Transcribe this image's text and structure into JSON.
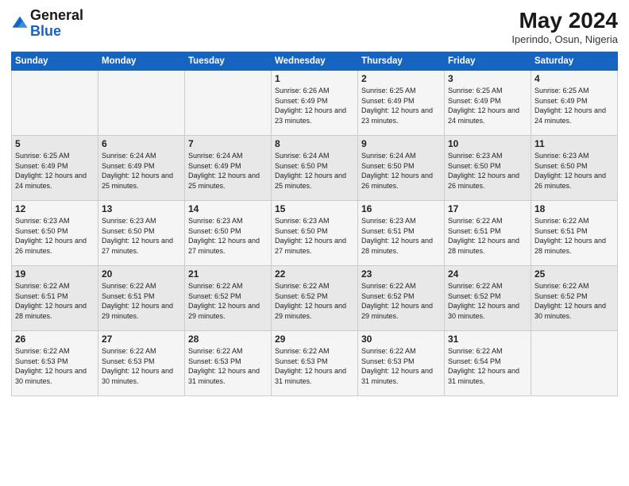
{
  "header": {
    "logo_general": "General",
    "logo_blue": "Blue",
    "month_year": "May 2024",
    "location": "Iperindo, Osun, Nigeria"
  },
  "days_of_week": [
    "Sunday",
    "Monday",
    "Tuesday",
    "Wednesday",
    "Thursday",
    "Friday",
    "Saturday"
  ],
  "weeks": [
    [
      {
        "day": "",
        "info": ""
      },
      {
        "day": "",
        "info": ""
      },
      {
        "day": "",
        "info": ""
      },
      {
        "day": "1",
        "info": "Sunrise: 6:26 AM\nSunset: 6:49 PM\nDaylight: 12 hours and 23 minutes."
      },
      {
        "day": "2",
        "info": "Sunrise: 6:25 AM\nSunset: 6:49 PM\nDaylight: 12 hours and 23 minutes."
      },
      {
        "day": "3",
        "info": "Sunrise: 6:25 AM\nSunset: 6:49 PM\nDaylight: 12 hours and 24 minutes."
      },
      {
        "day": "4",
        "info": "Sunrise: 6:25 AM\nSunset: 6:49 PM\nDaylight: 12 hours and 24 minutes."
      }
    ],
    [
      {
        "day": "5",
        "info": "Sunrise: 6:25 AM\nSunset: 6:49 PM\nDaylight: 12 hours and 24 minutes."
      },
      {
        "day": "6",
        "info": "Sunrise: 6:24 AM\nSunset: 6:49 PM\nDaylight: 12 hours and 25 minutes."
      },
      {
        "day": "7",
        "info": "Sunrise: 6:24 AM\nSunset: 6:49 PM\nDaylight: 12 hours and 25 minutes."
      },
      {
        "day": "8",
        "info": "Sunrise: 6:24 AM\nSunset: 6:50 PM\nDaylight: 12 hours and 25 minutes."
      },
      {
        "day": "9",
        "info": "Sunrise: 6:24 AM\nSunset: 6:50 PM\nDaylight: 12 hours and 26 minutes."
      },
      {
        "day": "10",
        "info": "Sunrise: 6:23 AM\nSunset: 6:50 PM\nDaylight: 12 hours and 26 minutes."
      },
      {
        "day": "11",
        "info": "Sunrise: 6:23 AM\nSunset: 6:50 PM\nDaylight: 12 hours and 26 minutes."
      }
    ],
    [
      {
        "day": "12",
        "info": "Sunrise: 6:23 AM\nSunset: 6:50 PM\nDaylight: 12 hours and 26 minutes."
      },
      {
        "day": "13",
        "info": "Sunrise: 6:23 AM\nSunset: 6:50 PM\nDaylight: 12 hours and 27 minutes."
      },
      {
        "day": "14",
        "info": "Sunrise: 6:23 AM\nSunset: 6:50 PM\nDaylight: 12 hours and 27 minutes."
      },
      {
        "day": "15",
        "info": "Sunrise: 6:23 AM\nSunset: 6:50 PM\nDaylight: 12 hours and 27 minutes."
      },
      {
        "day": "16",
        "info": "Sunrise: 6:23 AM\nSunset: 6:51 PM\nDaylight: 12 hours and 28 minutes."
      },
      {
        "day": "17",
        "info": "Sunrise: 6:22 AM\nSunset: 6:51 PM\nDaylight: 12 hours and 28 minutes."
      },
      {
        "day": "18",
        "info": "Sunrise: 6:22 AM\nSunset: 6:51 PM\nDaylight: 12 hours and 28 minutes."
      }
    ],
    [
      {
        "day": "19",
        "info": "Sunrise: 6:22 AM\nSunset: 6:51 PM\nDaylight: 12 hours and 28 minutes."
      },
      {
        "day": "20",
        "info": "Sunrise: 6:22 AM\nSunset: 6:51 PM\nDaylight: 12 hours and 29 minutes."
      },
      {
        "day": "21",
        "info": "Sunrise: 6:22 AM\nSunset: 6:52 PM\nDaylight: 12 hours and 29 minutes."
      },
      {
        "day": "22",
        "info": "Sunrise: 6:22 AM\nSunset: 6:52 PM\nDaylight: 12 hours and 29 minutes."
      },
      {
        "day": "23",
        "info": "Sunrise: 6:22 AM\nSunset: 6:52 PM\nDaylight: 12 hours and 29 minutes."
      },
      {
        "day": "24",
        "info": "Sunrise: 6:22 AM\nSunset: 6:52 PM\nDaylight: 12 hours and 30 minutes."
      },
      {
        "day": "25",
        "info": "Sunrise: 6:22 AM\nSunset: 6:52 PM\nDaylight: 12 hours and 30 minutes."
      }
    ],
    [
      {
        "day": "26",
        "info": "Sunrise: 6:22 AM\nSunset: 6:53 PM\nDaylight: 12 hours and 30 minutes."
      },
      {
        "day": "27",
        "info": "Sunrise: 6:22 AM\nSunset: 6:53 PM\nDaylight: 12 hours and 30 minutes."
      },
      {
        "day": "28",
        "info": "Sunrise: 6:22 AM\nSunset: 6:53 PM\nDaylight: 12 hours and 31 minutes."
      },
      {
        "day": "29",
        "info": "Sunrise: 6:22 AM\nSunset: 6:53 PM\nDaylight: 12 hours and 31 minutes."
      },
      {
        "day": "30",
        "info": "Sunrise: 6:22 AM\nSunset: 6:53 PM\nDaylight: 12 hours and 31 minutes."
      },
      {
        "day": "31",
        "info": "Sunrise: 6:22 AM\nSunset: 6:54 PM\nDaylight: 12 hours and 31 minutes."
      },
      {
        "day": "",
        "info": ""
      }
    ]
  ]
}
